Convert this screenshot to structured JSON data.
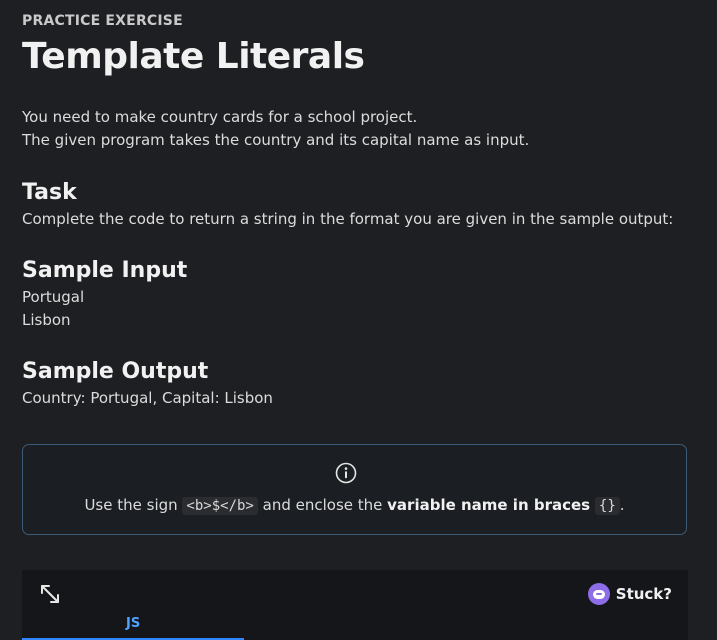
{
  "header": {
    "eyebrow": "PRACTICE EXERCISE",
    "title": "Template Literals"
  },
  "intro": {
    "line1": "You need to make country cards for a school project.",
    "line2": "The given program takes the country and its capital name as input."
  },
  "task": {
    "heading": "Task",
    "text": "Complete the code to return a string in the format you are given in the sample output:"
  },
  "sample_input": {
    "heading": "Sample Input",
    "lines": [
      "Portugal",
      "Lisbon"
    ]
  },
  "sample_output": {
    "heading": "Sample Output",
    "text": "Country: Portugal, Capital: Lisbon"
  },
  "hint": {
    "icon": "info-icon",
    "prefix": "Use the sign ",
    "code": "<b>$</b>",
    "middle": " and enclose the ",
    "bold": "variable name in braces",
    "code2": "{}",
    "suffix": "."
  },
  "editor": {
    "expand_icon": "expand-icon",
    "stuck_label": "Stuck?",
    "tab_label": "JS"
  },
  "colors": {
    "background": "#1e1f22",
    "hint_border": "#3b5a77",
    "accent": "#2f86ff",
    "bot": "#8e6de8"
  }
}
